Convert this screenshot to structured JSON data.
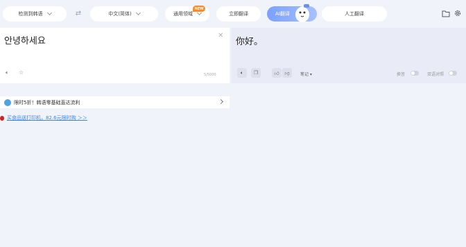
{
  "toolbar": {
    "source_lang": "检测到韩语",
    "target_lang": "中文(简体)",
    "domain": "通用领域",
    "new_badge": "NEW",
    "translate_button": "立即翻译",
    "ai_translate_button": "AI翻译",
    "human_translate_button": "人工翻译"
  },
  "source": {
    "text": "안녕하세요",
    "char_count": "5/5000"
  },
  "target": {
    "text": "你好。",
    "notes_label": "笔记",
    "option1_label": "换音",
    "option2_label": "双语对照"
  },
  "promo": {
    "text": "限时5折！韩语零基础直达流利"
  },
  "ad": {
    "text": "买食品送打印机，82.6元限时购 ＞＞"
  },
  "colors": {
    "accent": "#7aa0ff",
    "background": "#f1f3fb",
    "badge": "#ff8a2b"
  }
}
